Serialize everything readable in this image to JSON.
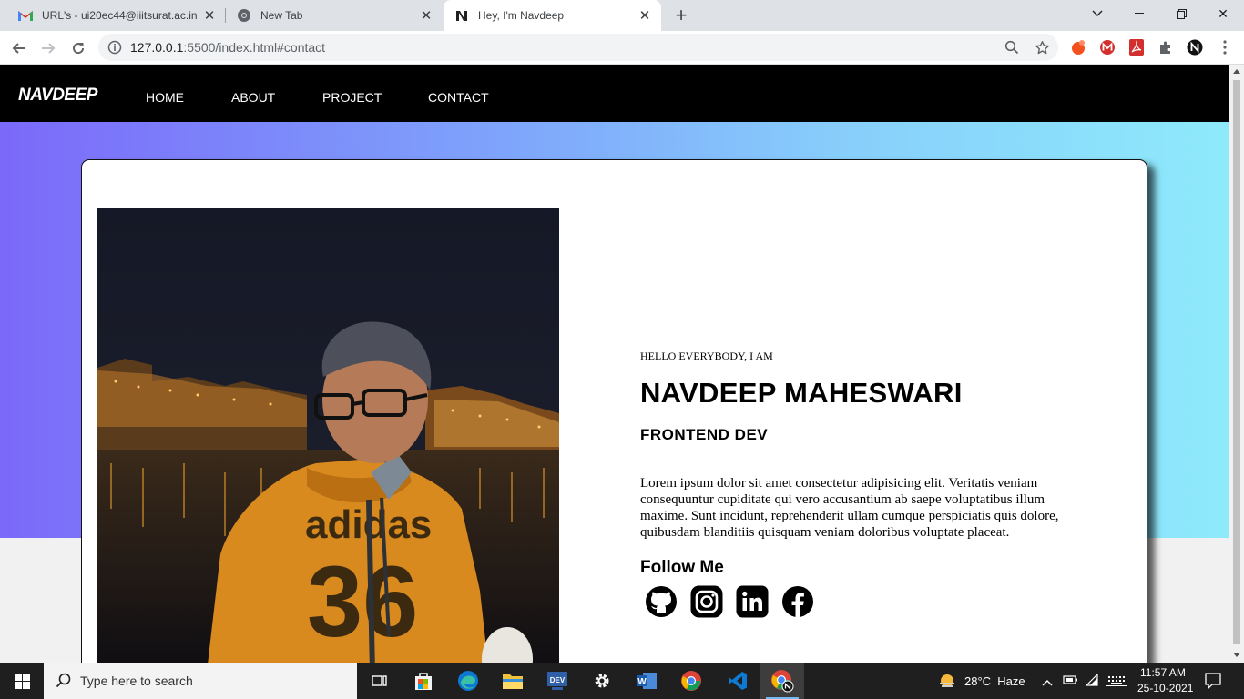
{
  "browser": {
    "tabs": [
      {
        "title": "URL's - ui20ec44@iiitsurat.ac.in -",
        "icon": "gmail-icon"
      },
      {
        "title": "New Tab",
        "icon": "chrome-icon"
      },
      {
        "title": "Hey, I'm Navdeep",
        "icon": "site-logo-icon",
        "active": true
      }
    ],
    "url_host": "127.0.0.1",
    "url_path": ":5500/index.html#contact"
  },
  "site": {
    "logo": "NAVDEEP",
    "nav": [
      "HOME",
      "ABOUT",
      "PROJECT",
      "CONTACT"
    ],
    "intro": "HELLO EVERYBODY, I AM",
    "name": "NAVDEEP MAHESWARI",
    "role": "FRONTEND DEV",
    "bio": "Lorem ipsum dolor sit amet consectetur adipisicing elit. Veritatis veniam consequuntur cupiditate qui vero accusantium ab saepe voluptatibus illum maxime. Sunt incidunt, reprehenderit ullam cumque perspiciatis quis dolore, quibusdam blanditiis quisquam veniam doloribus voluptate placeat.",
    "follow_label": "Follow Me",
    "socials": [
      "github-icon",
      "instagram-icon",
      "linkedin-icon",
      "facebook-icon"
    ],
    "photo_text": "adidas 36",
    "gradient": [
      "#7b69f9",
      "#8eeafb"
    ]
  },
  "taskbar": {
    "search_placeholder": "Type here to search",
    "weather": "28°C  Haze",
    "time": "11:57 AM",
    "date": "25-10-2021"
  }
}
